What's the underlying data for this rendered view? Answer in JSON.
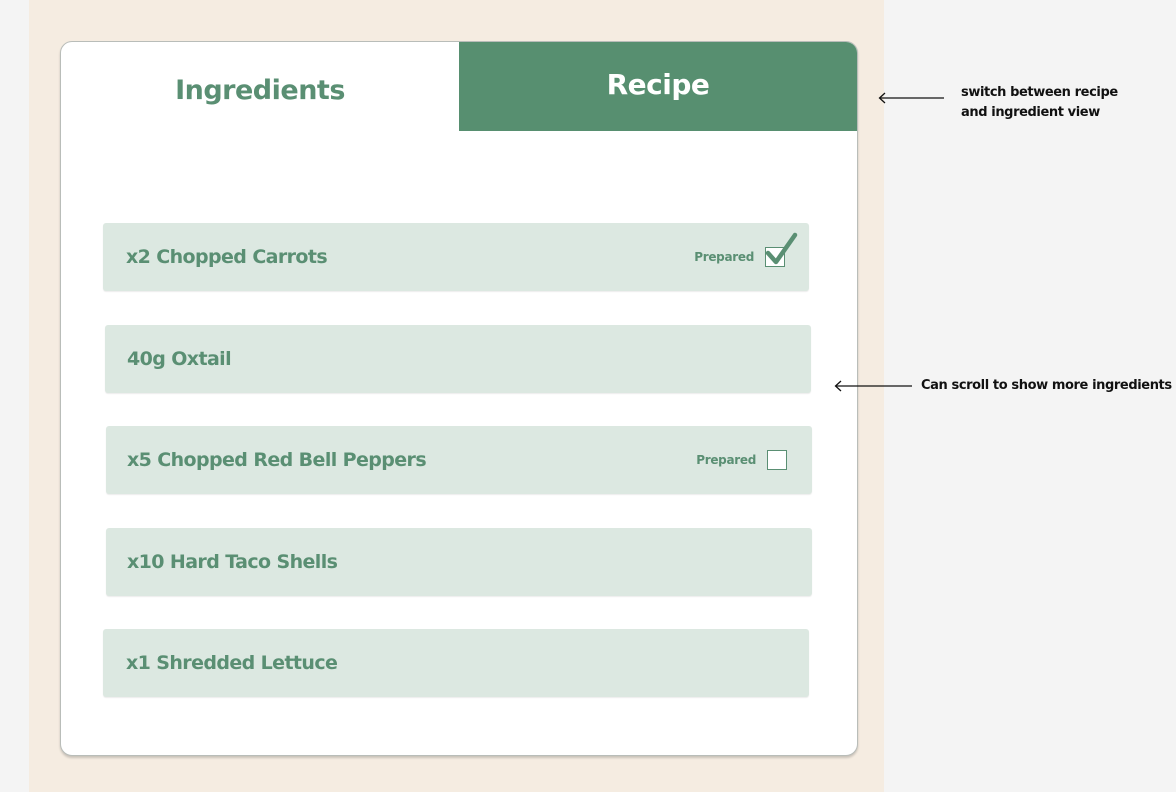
{
  "tabs": {
    "ingredients_label": "Ingredients",
    "recipe_label": "Recipe",
    "active": "ingredients"
  },
  "ingredients": [
    {
      "label": "x2 Chopped Carrots",
      "prepared_label": "Prepared",
      "prepared": true
    },
    {
      "label": "40g Oxtail"
    },
    {
      "label": "x5 Chopped Red Bell Peppers",
      "prepared_label": "Prepared",
      "prepared": false
    },
    {
      "label": "x10 Hard Taco Shells"
    },
    {
      "label": "x1 Shredded Lettuce"
    }
  ],
  "annotations": {
    "tab_note_line1": "switch between recipe",
    "tab_note_line2": "and ingredient view",
    "scroll_note": "Can scroll to show more ingredients"
  },
  "colors": {
    "accent_green": "#578f70",
    "row_background": "#dce8e1",
    "page_background": "#f5ece1"
  },
  "icons": [
    "checkmark-icon",
    "arrow-left-icon"
  ]
}
